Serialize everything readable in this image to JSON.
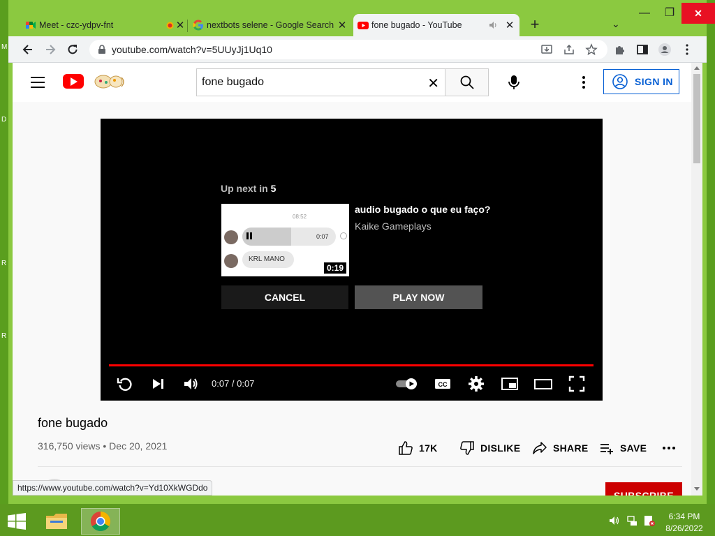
{
  "desktop": {
    "edge_letters": [
      "M",
      "D",
      "R",
      "R"
    ]
  },
  "browser": {
    "tabs": [
      {
        "title": "Meet - czc-ydpv-fnt",
        "favicon": "google-meet-icon",
        "indicator": "recording-dot-icon",
        "active": false
      },
      {
        "title": "nextbots selene - Google Search",
        "favicon": "google-icon",
        "active": false
      },
      {
        "title": "fone bugado - YouTube",
        "favicon": "youtube-icon",
        "indicator": "speaker-icon",
        "active": true
      }
    ],
    "url": "youtube.com/watch?v=5UUyJj1Uq10",
    "status_url": "https://www.youtube.com/watch?v=Yd10XkWGDdo"
  },
  "youtube": {
    "search_query": "fone bugado",
    "signin_label": "SIGN IN",
    "player": {
      "up_next_label": "Up next in",
      "countdown": "5",
      "next_title": "audio bugado o que eu faço?",
      "next_channel": "Kaike Gameplays",
      "next_duration": "0:19",
      "thumb_top_time": "08:52",
      "thumb_bubble_time": "0:07",
      "thumb_bubble_text": "KRL MANO",
      "cancel_label": "CANCEL",
      "play_now_label": "PLAY NOW",
      "time_display": "0:07 / 0:07",
      "progress_fraction": 1.0
    },
    "video": {
      "title": "fone bugado",
      "meta": "316,750 views • Dec 20, 2021",
      "likes": "17K",
      "dislike_label": "DISLIKE",
      "share_label": "SHARE",
      "save_label": "SAVE",
      "subscribe_label": "SUBSCRIBE"
    }
  },
  "taskbar": {
    "time": "6:34 PM",
    "date": "8/26/2022"
  },
  "colors": {
    "desktop_green": "#8bc940",
    "yt_red": "#ff0000",
    "link_blue": "#065fd4"
  }
}
